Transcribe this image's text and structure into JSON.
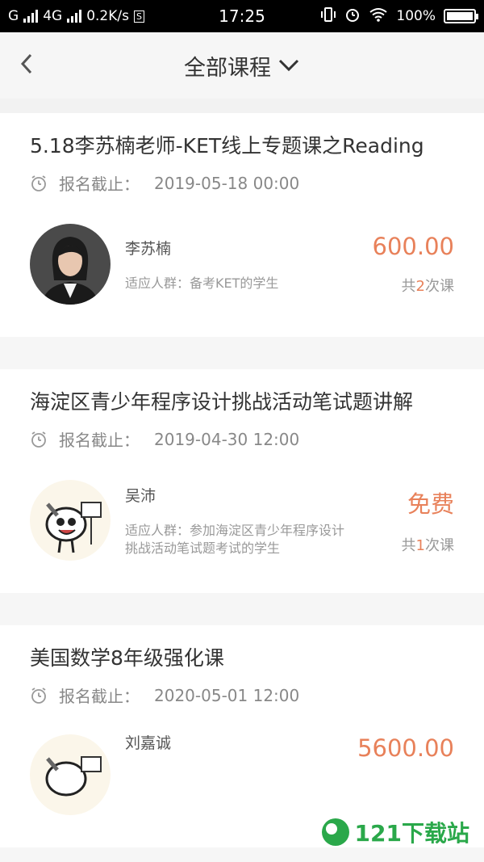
{
  "status_bar": {
    "carrier_signal": "G",
    "network": "4G",
    "speed": "0.2K/s",
    "s_badge": "S",
    "time": "17:25",
    "battery": "100%"
  },
  "header": {
    "title": "全部课程"
  },
  "courses": [
    {
      "title": "5.18李苏楠老师-KET线上专题课之Reading",
      "deadline_label": "报名截止：",
      "deadline": "2019-05-18 00:00",
      "teacher": "李苏楠",
      "audience": "适应人群：备考KET的学生",
      "price": "600.00",
      "lessons_prefix": "共",
      "lessons_count": "2",
      "lessons_suffix": "次课"
    },
    {
      "title": "海淀区青少年程序设计挑战活动笔试题讲解",
      "deadline_label": "报名截止：",
      "deadline": "2019-04-30 12:00",
      "teacher": "吴沛",
      "audience": "适应人群：参加海淀区青少年程序设计挑战活动笔试题考试的学生",
      "price": "免费",
      "lessons_prefix": "共",
      "lessons_count": "1",
      "lessons_suffix": "次课"
    },
    {
      "title": "美国数学8年级强化课",
      "deadline_label": "报名截止：",
      "deadline": "2020-05-01 12:00",
      "teacher": "刘嘉诚",
      "price": "5600.00"
    }
  ],
  "watermark": {
    "text": "121下载站"
  },
  "icons": {
    "back": "chevron-left-icon",
    "dropdown": "chevron-down-icon",
    "clock": "alarm-clock-icon"
  },
  "colors": {
    "price": "#e8815a",
    "background": "#f6f6f6"
  }
}
